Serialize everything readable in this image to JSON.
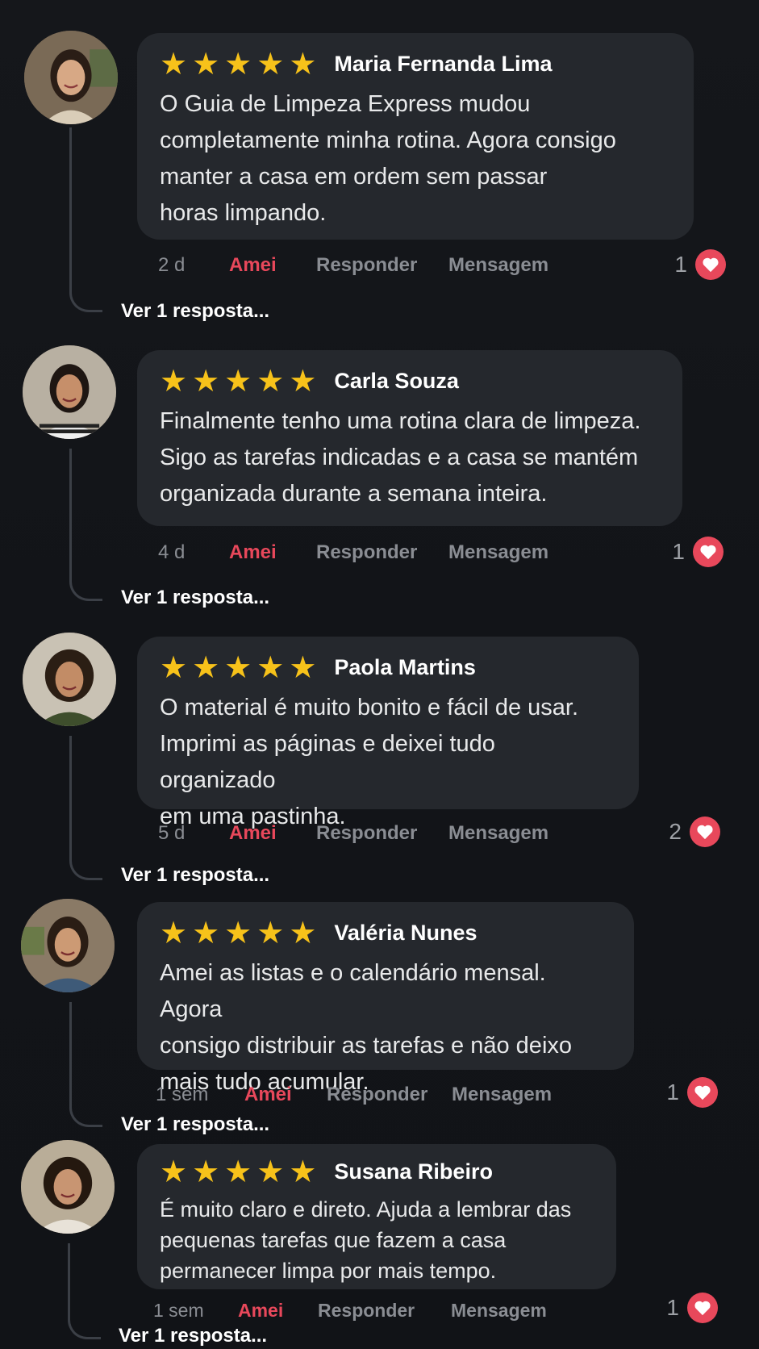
{
  "comments": [
    {
      "name": "Maria Fernanda Lima",
      "text": "O Guia de Limpeza Express mudou\ncompletamente minha rotina. Agora consigo\nmanter a casa em ordem sem passar\nhoras limpando.",
      "rating": 5,
      "time": "2 d",
      "love_label": "Amei",
      "reply_label": "Responder",
      "message_label": "Mensagem",
      "likes": "1",
      "view_replies": "Ver 1 resposta..."
    },
    {
      "name": "Carla Souza",
      "text": "Finalmente tenho uma rotina clara de limpeza.\nSigo as tarefas indicadas e a casa se mantém\norganizada durante a semana inteira.",
      "rating": 5,
      "time": "4 d",
      "love_label": "Amei",
      "reply_label": "Responder",
      "message_label": "Mensagem",
      "likes": "1",
      "view_replies": "Ver 1 resposta..."
    },
    {
      "name": "Paola Martins",
      "text": "O material é muito bonito e fácil de usar.\nImprimi as páginas e deixei tudo organizado\nem uma pastinha.",
      "rating": 5,
      "time": "5 d",
      "love_label": "Amei",
      "reply_label": "Responder",
      "message_label": "Mensagem",
      "likes": "2",
      "view_replies": "Ver 1 resposta..."
    },
    {
      "name": "Valéria Nunes",
      "text": "Amei as listas e o calendário mensal. Agora\nconsigo distribuir as tarefas e não deixo\nmais tudo acumular.",
      "rating": 5,
      "time": "1 sem",
      "love_label": "Amei",
      "reply_label": "Responder",
      "message_label": "Mensagem",
      "likes": "1",
      "view_replies": "Ver 1 resposta..."
    },
    {
      "name": "Susana Ribeiro",
      "text": "É muito claro e direto. Ajuda a lembrar das\npequenas tarefas que fazem a casa\npermanecer limpa por mais tempo.",
      "rating": 5,
      "time": "1 sem",
      "love_label": "Amei",
      "reply_label": "Responder",
      "message_label": "Mensagem",
      "likes": "1",
      "view_replies": "Ver 1 resposta..."
    }
  ],
  "icons": {
    "star": "star-icon",
    "heart": "heart-icon",
    "avatar": "avatar-photo"
  },
  "colors": {
    "star": "#f7c21a",
    "love": "#e8485b",
    "bubble": "#25282d",
    "background": "#121418"
  }
}
